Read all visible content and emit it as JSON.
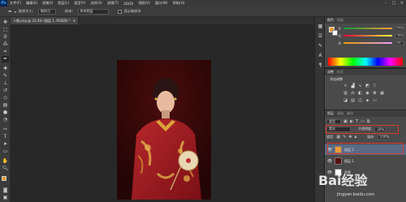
{
  "app": {
    "logo": "Ps"
  },
  "menu": [
    "文件(F)",
    "编辑(E)",
    "图像(I)",
    "图层(L)",
    "类型(Y)",
    "选择(S)",
    "滤镜(T)",
    "3D(D)",
    "视图(V)",
    "窗口(W)",
    "帮助(H)"
  ],
  "window_controls": {
    "minimize": "–",
    "maximize": "□",
    "close": "✕"
  },
  "options": {
    "size_label": "取样大小：",
    "size_value": "取样点",
    "sample_label": "样本：",
    "sample_value": "所有图层",
    "show_ring_label": "显示取样环"
  },
  "document": {
    "tab_title": "人物.png @ 33.3% (图层 1, RGB/8) *"
  },
  "panels": {
    "color": {
      "tab": "颜色",
      "swatches_tab": "色板",
      "r": {
        "label": "R",
        "value": "233"
      },
      "g": {
        "label": "G",
        "value": "155"
      },
      "b": {
        "label": "B",
        "value": "54"
      }
    },
    "adjustments": {
      "tab": "调整",
      "styles_tab": "样式",
      "title": "添加调整"
    },
    "layers": {
      "tabs": [
        "图层",
        "通道",
        "路径"
      ],
      "filter": "类型",
      "blend_mode": "柔光",
      "opacity_label": "不透明度:",
      "opacity_value": "20%",
      "lock_label": "锁定:",
      "fill_label": "填充:",
      "fill_value": "100%",
      "items": [
        {
          "name": "图层 2"
        },
        {
          "name": "图层 1"
        },
        {
          "name": "背景"
        }
      ]
    }
  },
  "watermark": {
    "text": "Bai经验",
    "url": "jingyan.baidu.com"
  },
  "colors": {
    "highlight": "#d83a2a",
    "foreground": "#e99b36"
  }
}
